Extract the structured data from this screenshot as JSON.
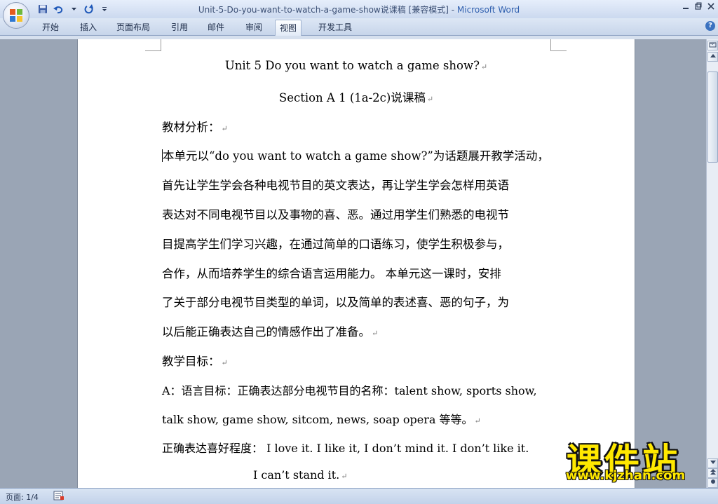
{
  "titlebar": {
    "doc_title": "Unit-5-Do-you-want-to-watch-a-game-show说课稿 [兼容模式]",
    "separator": " - ",
    "app_name": "Microsoft Word"
  },
  "ribbon": {
    "tabs": [
      {
        "label": "开始"
      },
      {
        "label": "插入"
      },
      {
        "label": "页面布局"
      },
      {
        "label": "引用"
      },
      {
        "label": "邮件"
      },
      {
        "label": "审阅"
      },
      {
        "label": "视图"
      },
      {
        "label": "开发工具"
      }
    ],
    "active_tab": "视图"
  },
  "document": {
    "title": "Unit 5 Do you want to watch a game show?",
    "subtitle": "Section A 1 (1a-2c)说课稿",
    "heading1": "教材分析：",
    "para1": [
      "本单元以“do you want to watch a game show?”为话题展开教学活动，",
      "首先让学生学会各种电视节目的英文表达，再让学生学会怎样用英语",
      "表达对不同电视节目以及事物的喜、恶。通过用学生们熟悉的电视节",
      "目提高学生们学习兴趣，在通过简单的口语练习，使学生积极参与，",
      "合作，从而培养学生的综合语言运用能力。 本单元这一课时，安排",
      "了关于部分电视节目类型的单词，以及简单的表述喜、恶的句子，为",
      "以后能正确表达自己的情感作出了准备。"
    ],
    "heading2": "教学目标：",
    "goal_a1": "A：语言目标：正确表达部分电视节目的名称：talent show, sports show,",
    "goal_a2": "talk show, game show, sitcom, news, soap opera 等等。",
    "goal_b1": "正确表达喜好程度： I love it. I like it, I don’t mind it. I don’t like it.",
    "goal_b2": "I can’t stand it.",
    "para_mark": "↵"
  },
  "statusbar": {
    "page_label": "页面: 1/4"
  },
  "watermark": {
    "big": "课件站",
    "small": "www.kjzhan.com"
  },
  "colors": {
    "chrome": "#cbd9ef",
    "page": "#ffffff",
    "workspace": "#9aa5b5",
    "watermark": "#ffe800"
  }
}
